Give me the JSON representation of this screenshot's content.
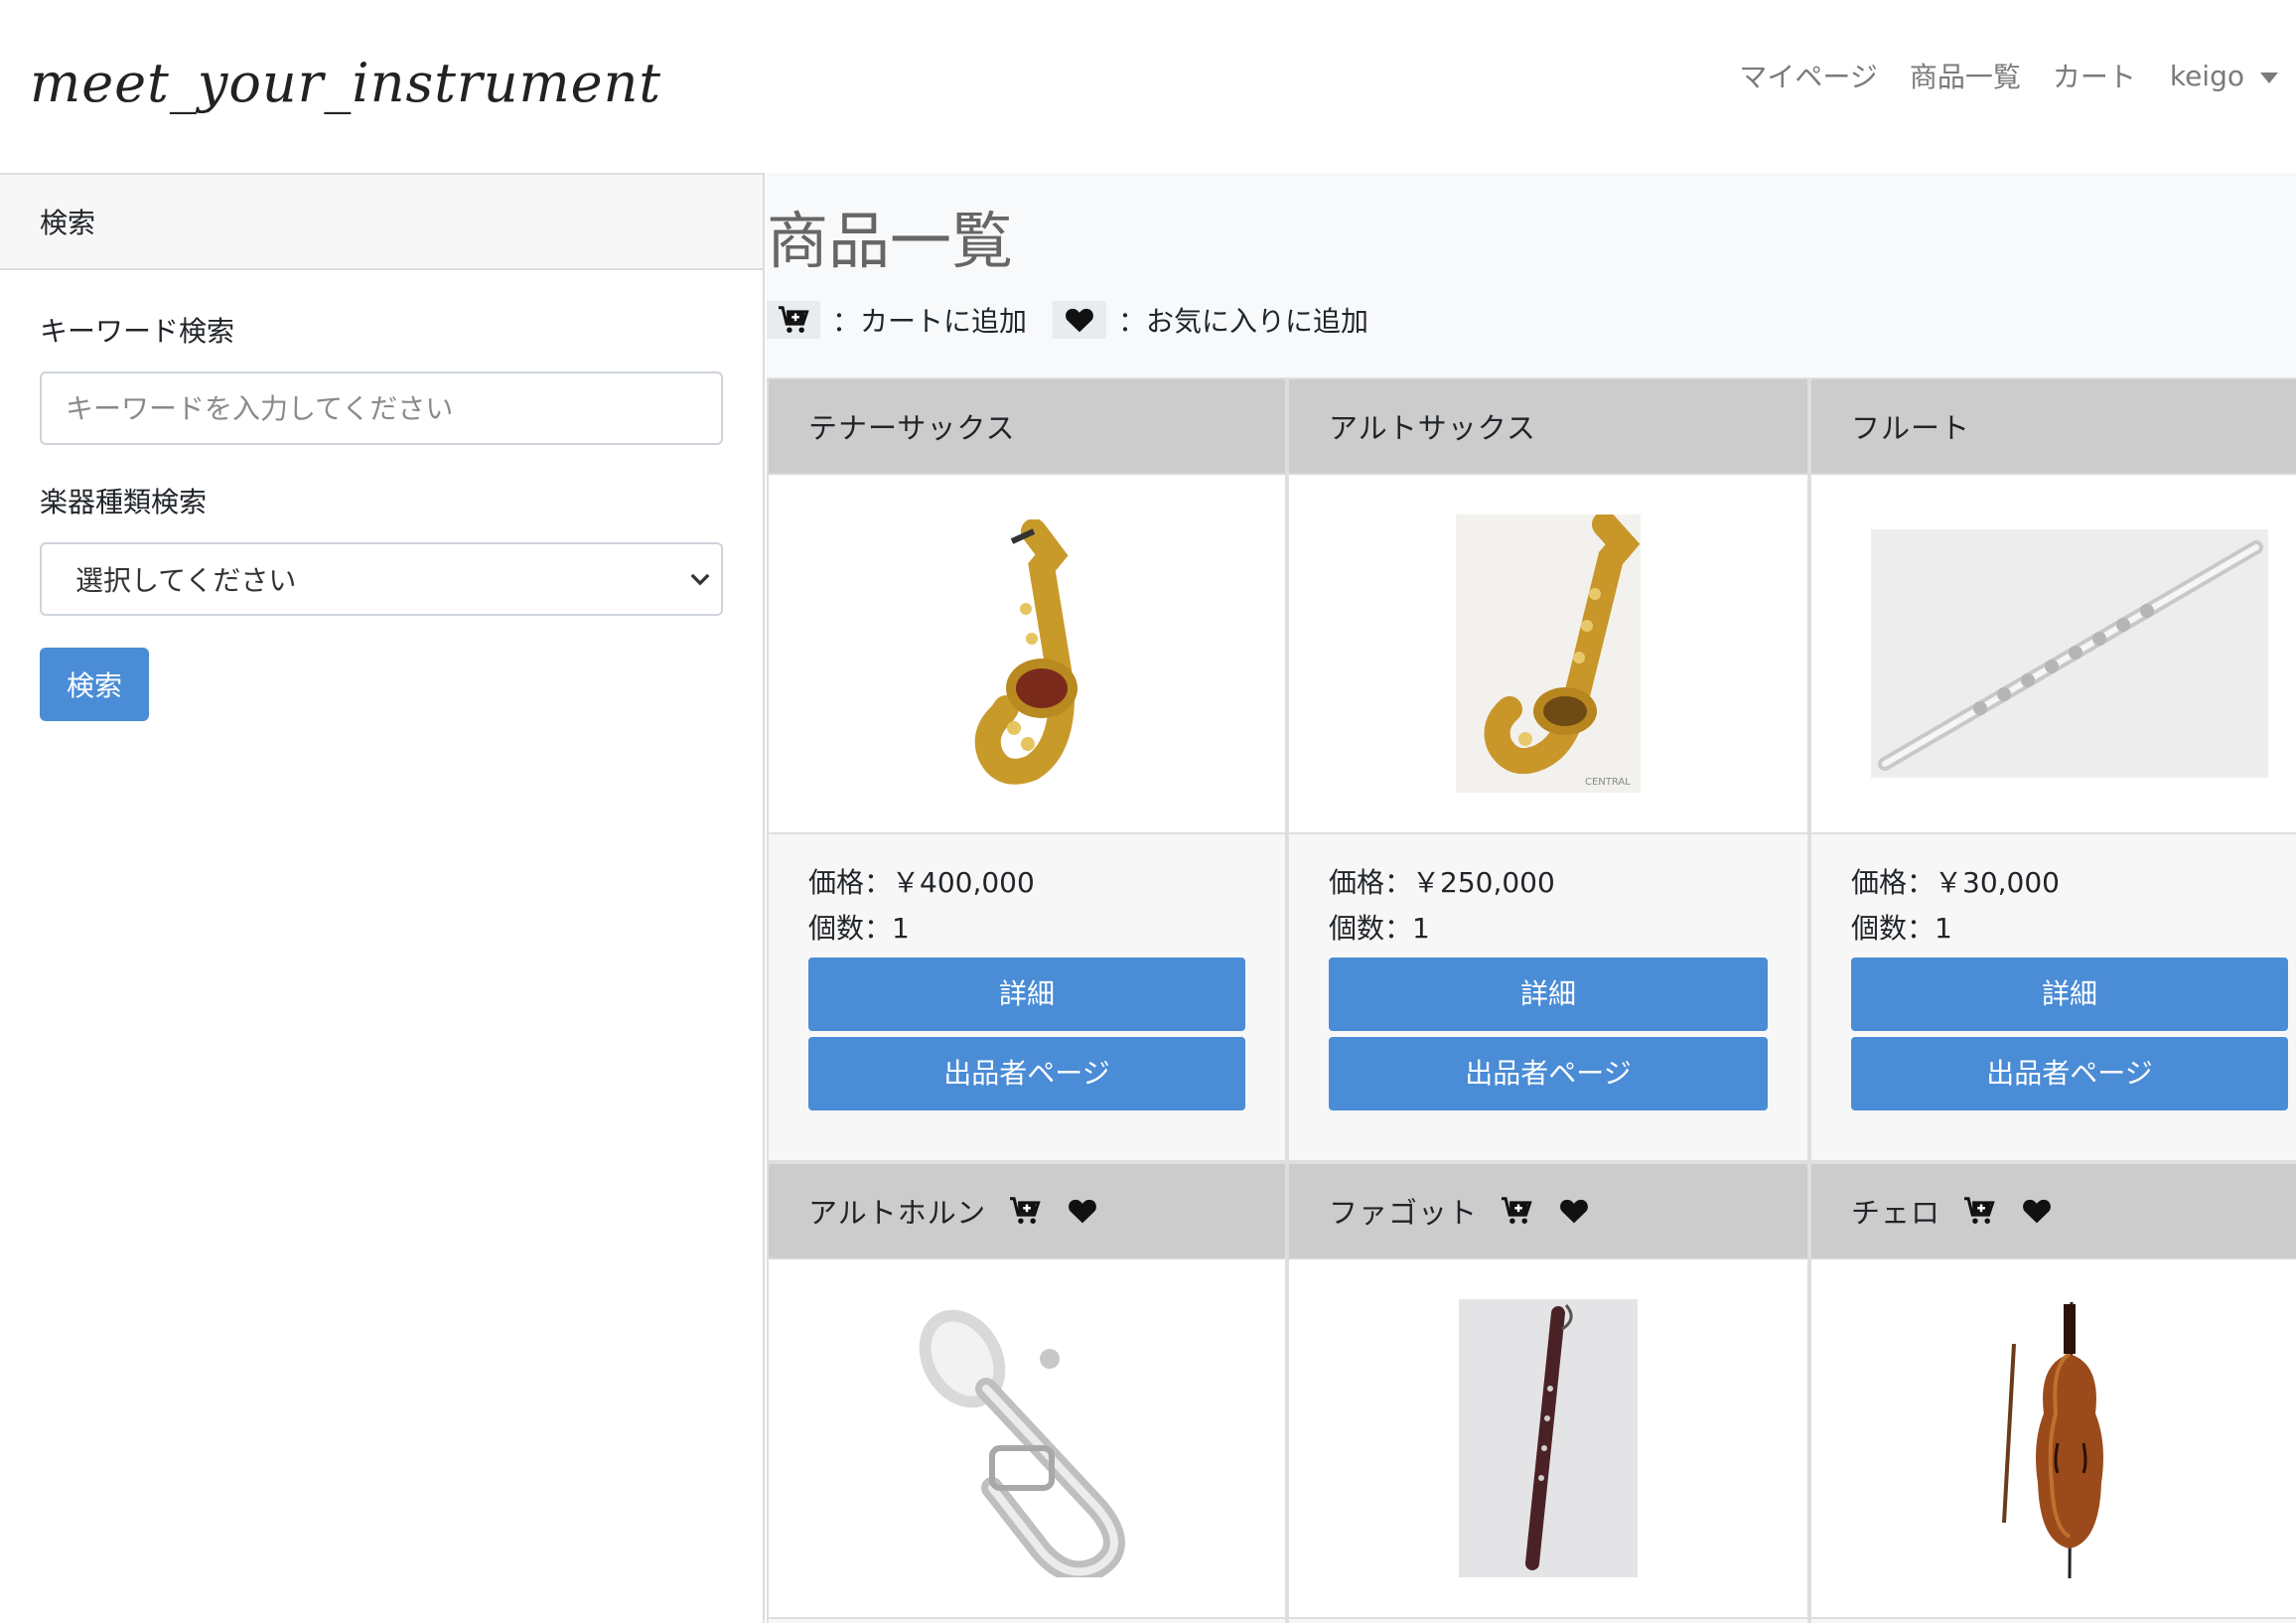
{
  "brand": "meet_your_instrument",
  "nav": {
    "mypage": "マイページ",
    "products": "商品一覧",
    "cart": "カート",
    "user": "keigo"
  },
  "sidebar": {
    "header": "検索",
    "keyword_label": "キーワード検索",
    "keyword_placeholder": "キーワードを入力してください",
    "type_label": "楽器種類検索",
    "type_selected": "選択してください",
    "search_button": "検索"
  },
  "main": {
    "title": "商品一覧",
    "legend_cart": "：カートに追加",
    "legend_fav": "：お気に入りに追加"
  },
  "products": [
    {
      "name": "テナーサックス",
      "price": "価格：￥400,000",
      "qty": "個数：1",
      "detail": "詳細",
      "seller": "出品者ページ"
    },
    {
      "name": "アルトサックス",
      "price": "価格：￥250,000",
      "qty": "個数：1",
      "detail": "詳細",
      "seller": "出品者ページ"
    },
    {
      "name": "フルート",
      "price": "価格：￥30,000",
      "qty": "個数：1",
      "detail": "詳細",
      "seller": "出品者ページ"
    },
    {
      "name": "アルトホルン"
    },
    {
      "name": "ファゴット"
    },
    {
      "name": "チェロ"
    }
  ],
  "colors": {
    "primary": "#4a8cd6",
    "card_header": "#cccccc",
    "nav_text": "#7a7a7a"
  }
}
